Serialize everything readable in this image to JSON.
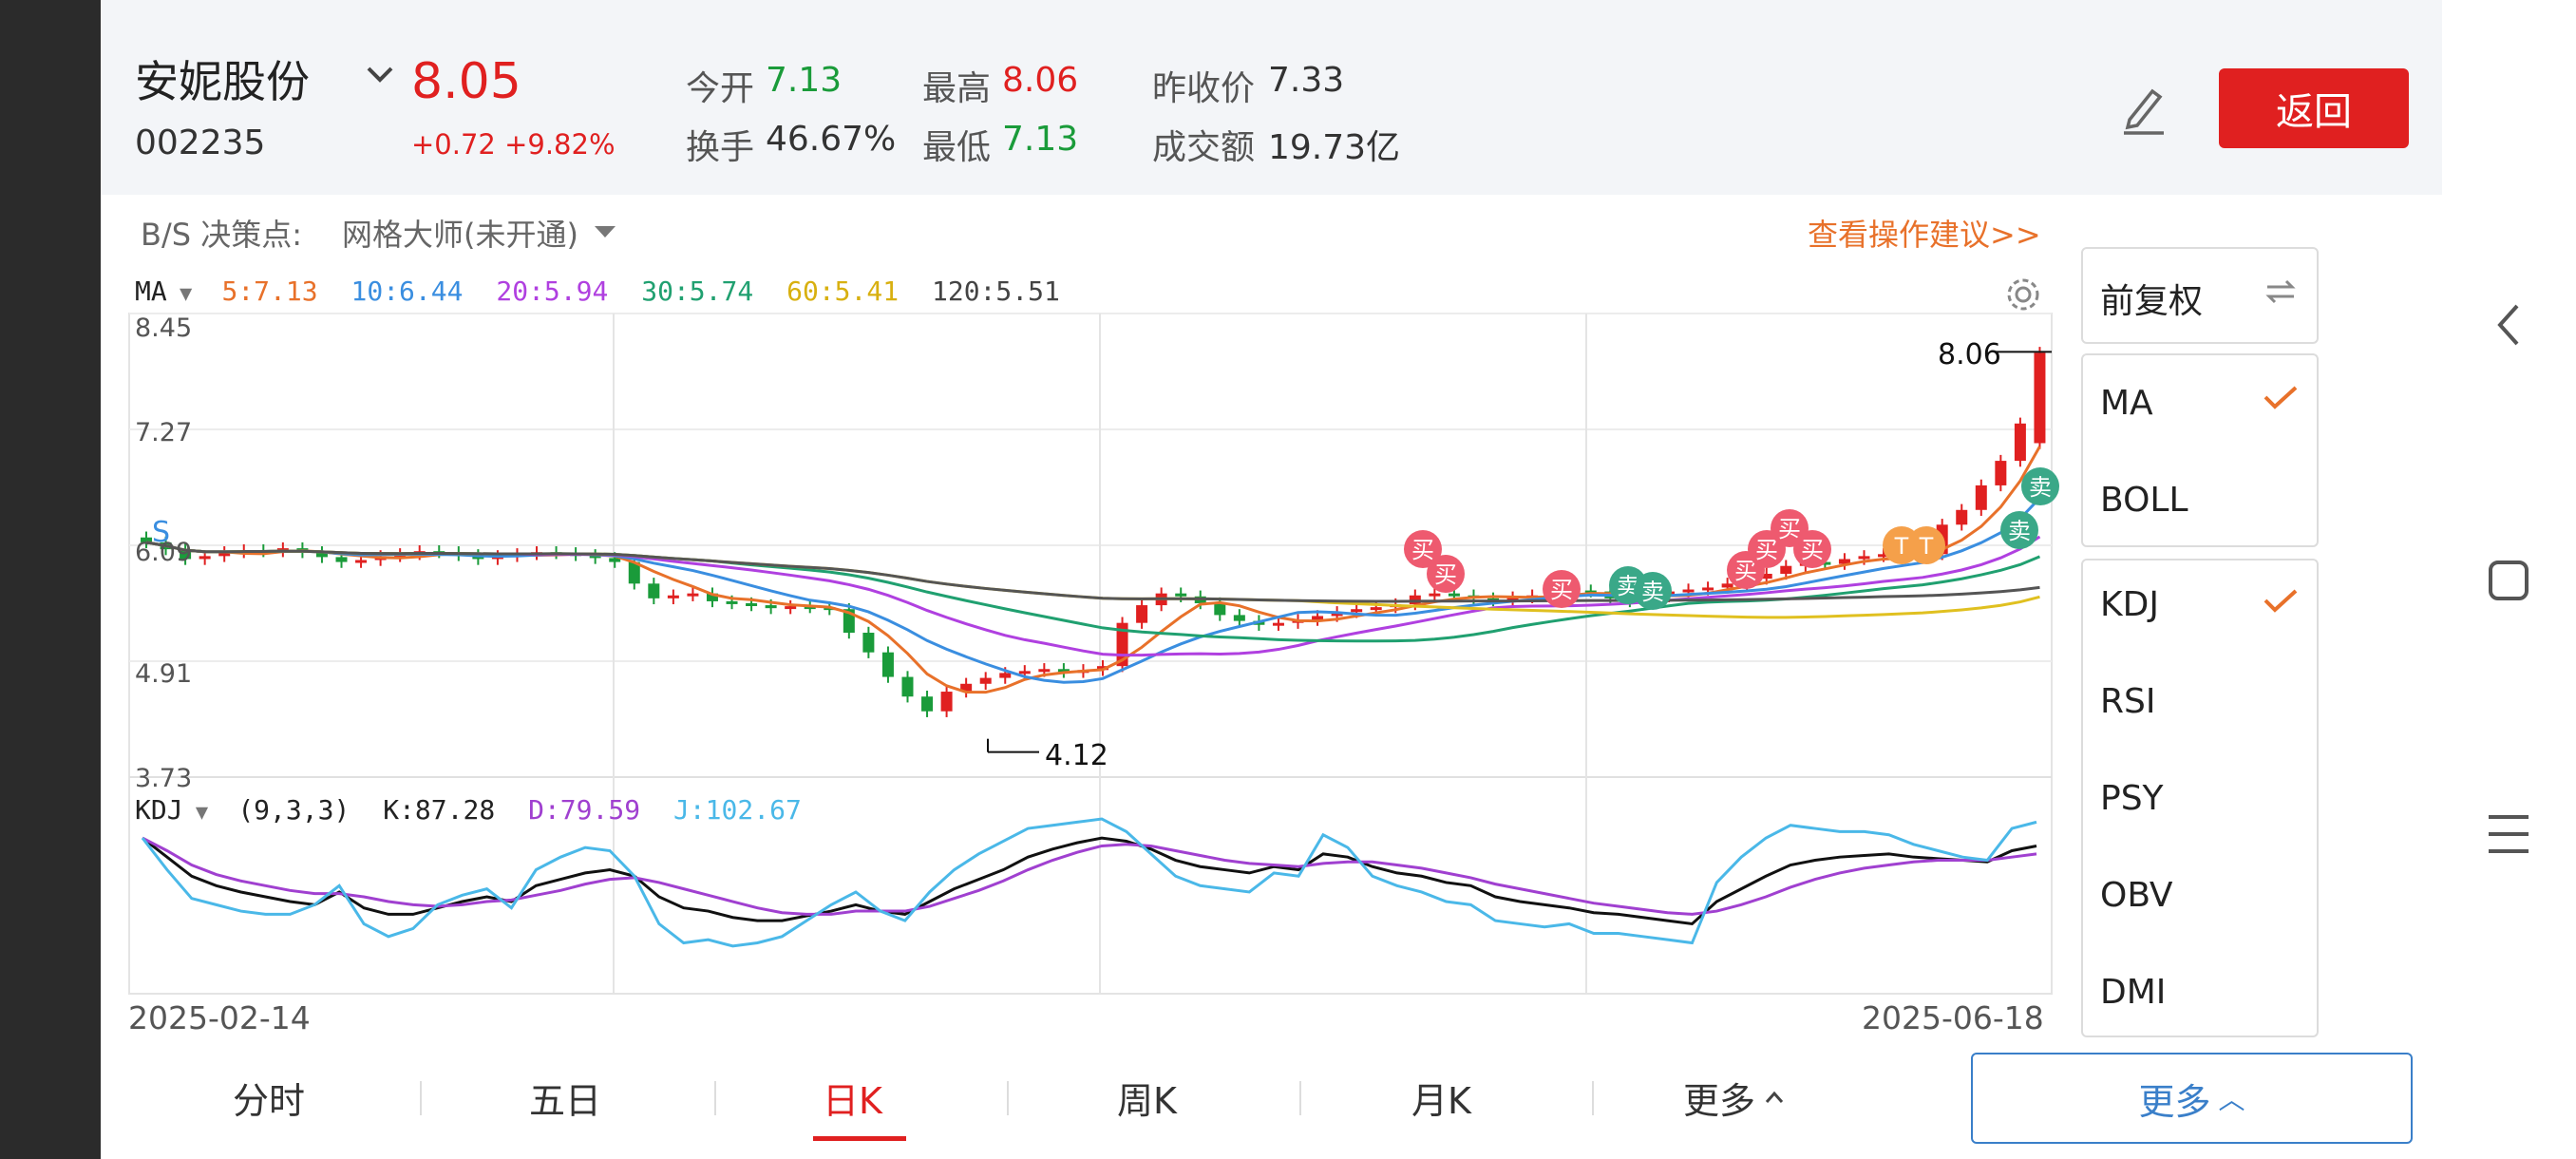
{
  "header": {
    "stock_name": "安妮股份",
    "stock_code": "002235",
    "price": "8.05",
    "change": "+0.72 +9.82%",
    "quotes": [
      {
        "label": "今开",
        "value": "7.13",
        "tone": "green"
      },
      {
        "label": "最高",
        "value": "8.06",
        "tone": "red"
      },
      {
        "label": "昨收价",
        "value": "7.33",
        "tone": "black"
      },
      {
        "label": "换手",
        "value": "46.67%",
        "tone": "black"
      },
      {
        "label": "最低",
        "value": "7.13",
        "tone": "green"
      },
      {
        "label": "成交额",
        "value": "19.73亿",
        "tone": "black"
      }
    ],
    "back_label": "返回"
  },
  "toolbar": {
    "bs_label": "B/S 决策点:",
    "grid_label": "网格大师(未开通)",
    "advice_label": "查看操作建议>>"
  },
  "ma_legend": {
    "label": "MA",
    "items": [
      "5:7.13",
      "10:6.44",
      "20:5.94",
      "30:5.74",
      "60:5.41",
      "120:5.51"
    ]
  },
  "kdj_legend": {
    "label": "KDJ",
    "params": "(9,3,3)",
    "items": [
      "K:87.28",
      "D:79.59",
      "J:102.67"
    ]
  },
  "price_axis": [
    "8.45",
    "7.27",
    "6.09",
    "4.91",
    "3.73"
  ],
  "dates": {
    "start": "2025-02-14",
    "end": "2025-06-18"
  },
  "annotations": {
    "high": "8.06",
    "low": "4.12"
  },
  "markers": {
    "buy": "买",
    "sell": "卖",
    "t": "T",
    "s": "S"
  },
  "panel": {
    "adjust": "前复权",
    "main_indicators": [
      {
        "label": "MA",
        "checked": true
      },
      {
        "label": "BOLL",
        "checked": false
      }
    ],
    "sub_indicators": [
      {
        "label": "KDJ",
        "checked": true
      },
      {
        "label": "RSI",
        "checked": false
      },
      {
        "label": "PSY",
        "checked": false
      },
      {
        "label": "OBV",
        "checked": false
      },
      {
        "label": "DMI",
        "checked": false
      }
    ]
  },
  "tabs": [
    "分时",
    "五日",
    "日K",
    "周K",
    "月K",
    "更多"
  ],
  "active_tab": "日K",
  "more_button": "更多",
  "colors": {
    "up": "#e02020",
    "down": "#1a9b3a",
    "ma5": "#e8712a",
    "ma10": "#3a8ee0",
    "ma20": "#b040e0",
    "ma30": "#20a070",
    "ma60": "#e0c020",
    "ma120": "#555555",
    "k": "#111111",
    "d": "#a040d0",
    "j": "#4ab8e8",
    "accent": "#e02020",
    "link": "#3a7fc9"
  },
  "chart_data": {
    "type": "candlestick",
    "y_range": [
      3.73,
      8.45
    ],
    "low_price": 4.12,
    "high_price": 8.06,
    "closes": [
      6.12,
      6.05,
      5.95,
      5.98,
      6.02,
      6.04,
      6.03,
      6.06,
      6.02,
      5.97,
      5.92,
      5.94,
      5.98,
      6.0,
      6.03,
      6.02,
      5.99,
      5.95,
      5.98,
      6.0,
      6.02,
      6.01,
      5.99,
      5.96,
      5.92,
      5.7,
      5.55,
      5.58,
      5.6,
      5.52,
      5.5,
      5.48,
      5.45,
      5.47,
      5.46,
      5.44,
      5.2,
      5.0,
      4.75,
      4.55,
      4.4,
      4.6,
      4.68,
      4.74,
      4.79,
      4.81,
      4.83,
      4.8,
      4.82,
      4.86,
      5.3,
      5.48,
      5.6,
      5.57,
      5.5,
      5.38,
      5.32,
      5.28,
      5.3,
      5.33,
      5.37,
      5.41,
      5.44,
      5.46,
      5.49,
      5.58,
      5.6,
      5.58,
      5.55,
      5.53,
      5.56,
      5.58,
      5.61,
      5.63,
      5.62,
      5.55,
      5.52,
      5.57,
      5.62,
      5.64,
      5.66,
      5.7,
      5.75,
      5.8,
      5.88,
      5.92,
      5.9,
      5.95,
      5.98,
      6.0,
      5.96,
      6.0,
      6.3,
      6.45,
      6.7,
      6.95,
      7.33,
      8.05
    ]
  },
  "kdj_data": {
    "k": [
      92,
      80,
      68,
      62,
      58,
      55,
      52,
      50,
      58,
      48,
      44,
      44,
      48,
      52,
      55,
      52,
      62,
      66,
      70,
      72,
      68,
      55,
      48,
      46,
      42,
      40,
      40,
      43,
      46,
      50,
      46,
      44,
      52,
      60,
      66,
      72,
      80,
      85,
      89,
      92,
      90,
      85,
      78,
      74,
      72,
      70,
      74,
      72,
      82,
      80,
      74,
      70,
      68,
      64,
      62,
      55,
      52,
      50,
      48,
      45,
      44,
      42,
      40,
      38,
      52,
      60,
      68,
      75,
      78,
      80,
      81,
      82,
      80,
      79,
      78,
      77,
      84,
      87
    ],
    "d": [
      92,
      84,
      75,
      69,
      65,
      62,
      59,
      57,
      57,
      55,
      52,
      50,
      49,
      50,
      52,
      53,
      56,
      59,
      63,
      66,
      67,
      64,
      60,
      56,
      52,
      48,
      45,
      44,
      44,
      46,
      46,
      46,
      49,
      54,
      59,
      65,
      72,
      78,
      83,
      87,
      88,
      87,
      84,
      81,
      78,
      76,
      75,
      74,
      76,
      77,
      77,
      75,
      73,
      70,
      67,
      63,
      60,
      57,
      54,
      51,
      49,
      47,
      45,
      44,
      46,
      50,
      55,
      61,
      66,
      70,
      73,
      75,
      77,
      78,
      78,
      78,
      80,
      82
    ],
    "j": [
      92,
      72,
      54,
      50,
      46,
      44,
      44,
      50,
      62,
      38,
      30,
      35,
      50,
      56,
      60,
      48,
      72,
      80,
      86,
      84,
      68,
      38,
      26,
      28,
      24,
      26,
      30,
      40,
      50,
      58,
      46,
      40,
      58,
      72,
      82,
      90,
      98,
      100,
      102,
      104,
      96,
      82,
      68,
      62,
      60,
      58,
      70,
      68,
      94,
      86,
      68,
      62,
      58,
      52,
      50,
      40,
      38,
      36,
      38,
      32,
      32,
      30,
      28,
      26,
      64,
      80,
      92,
      100,
      98,
      96,
      96,
      94,
      88,
      84,
      80,
      78,
      98,
      102
    ]
  }
}
